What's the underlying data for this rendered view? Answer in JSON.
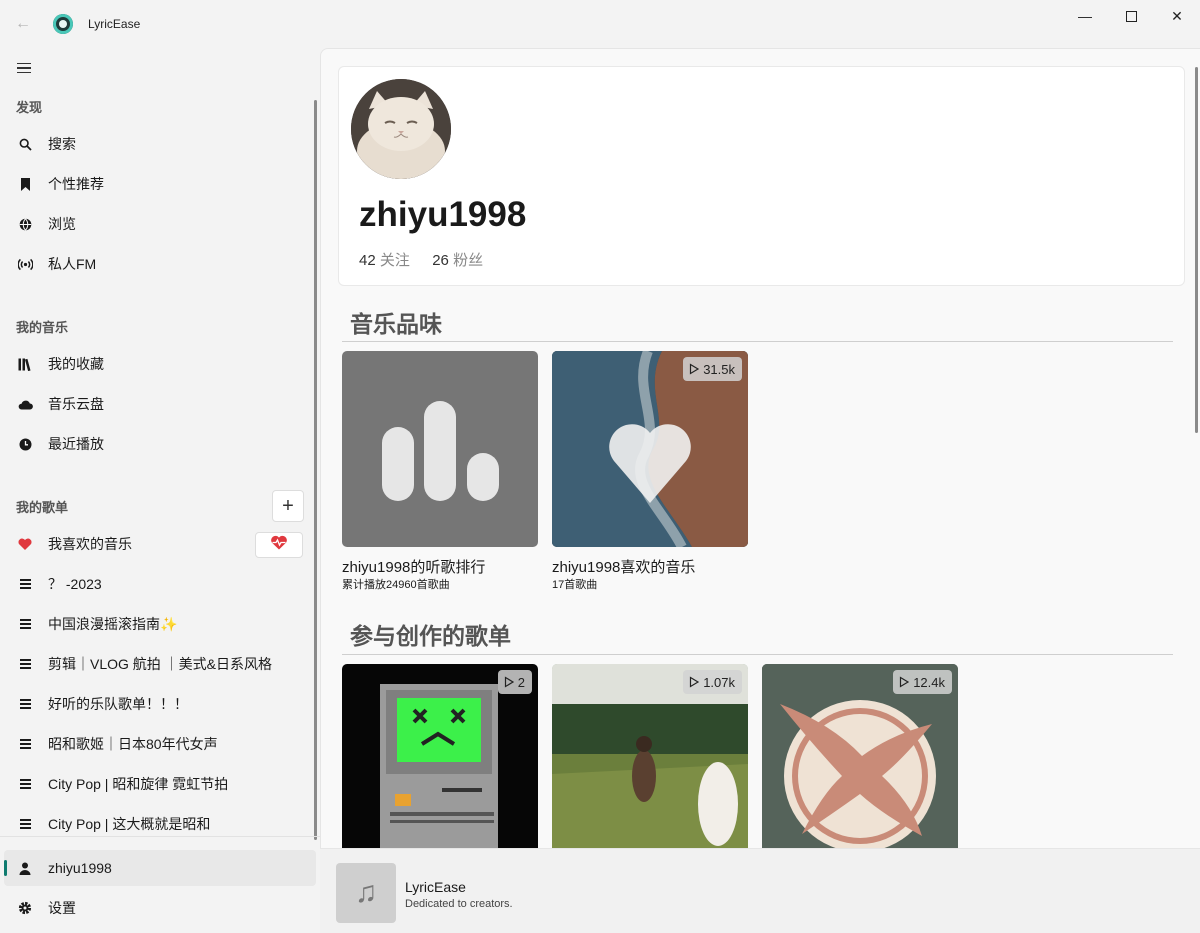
{
  "app": {
    "title": "LyricEase"
  },
  "sidebar": {
    "discover_title": "发现",
    "discover": [
      {
        "label": "搜索",
        "icon": "search-icon"
      },
      {
        "label": "个性推荐",
        "icon": "bookmark-icon"
      },
      {
        "label": "浏览",
        "icon": "globe-icon"
      },
      {
        "label": "私人FM",
        "icon": "radio-icon"
      }
    ],
    "my_music_title": "我的音乐",
    "my_music": [
      {
        "label": "我的收藏",
        "icon": "library-icon"
      },
      {
        "label": "音乐云盘",
        "icon": "cloud-icon"
      },
      {
        "label": "最近播放",
        "icon": "clock-icon"
      }
    ],
    "playlists_title": "我的歌单",
    "playlists": [
      {
        "label": "我喜欢的音乐",
        "icon": "heart-icon"
      },
      {
        "label": "？ -2023",
        "icon": "list-icon"
      },
      {
        "label": "中国浪漫摇滚指南✨",
        "icon": "list-icon"
      },
      {
        "label": "剪辑｜VLOG 航拍 ｜美式&日系风格",
        "icon": "list-icon"
      },
      {
        "label": "好听的乐队歌单！！！",
        "icon": "list-icon"
      },
      {
        "label": "昭和歌姬｜日本80年代女声",
        "icon": "list-icon"
      },
      {
        "label": "City Pop | 昭和旋律 霓虹节拍",
        "icon": "list-icon"
      },
      {
        "label": "City Pop | 这大概就是昭和",
        "icon": "list-icon"
      }
    ],
    "account_label": "zhiyu1998",
    "settings_label": "设置",
    "accent_color": "#0f7b6f",
    "heart_color": "#e0383e"
  },
  "profile": {
    "username": "zhiyu1998",
    "following_count": "42",
    "following_label": "关注",
    "followers_count": "26",
    "followers_label": "粉丝"
  },
  "taste": {
    "heading": "音乐品味",
    "cards": [
      {
        "title": "zhiyu1998的听歌排行",
        "subtitle": "累计播放24960首歌曲"
      },
      {
        "title": "zhiyu1998喜欢的音乐",
        "subtitle": "17首歌曲",
        "plays": "31.5k"
      }
    ]
  },
  "created": {
    "heading": "参与创作的歌单",
    "cards": [
      {
        "plays": "2"
      },
      {
        "plays": "1.07k"
      },
      {
        "plays": "12.4k"
      }
    ]
  },
  "player": {
    "title": "LyricEase",
    "subtitle": "Dedicated to creators."
  }
}
